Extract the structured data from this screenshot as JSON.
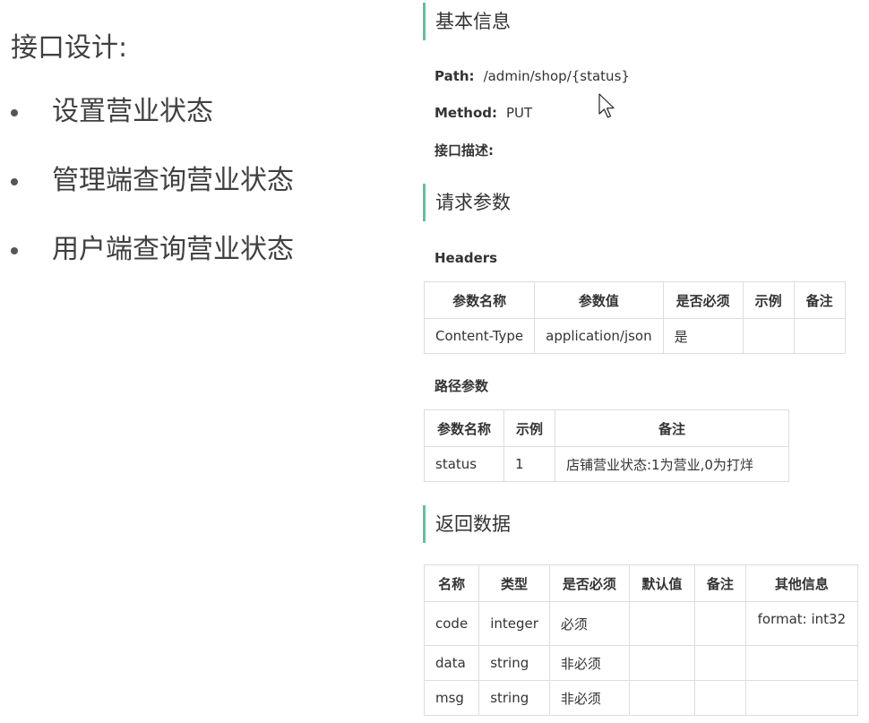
{
  "slide": {
    "title": "接口设计:",
    "bullets": [
      "设置营业状态",
      "管理端查询营业状态",
      "用户端查询营业状态"
    ]
  },
  "basic_info": {
    "heading": "基本信息",
    "path_label": "Path:",
    "path_value": "/admin/shop/{status}",
    "method_label": "Method:",
    "method_value": "PUT",
    "desc_label": "接口描述:"
  },
  "request": {
    "heading": "请求参数",
    "headers_label": "Headers",
    "headers_table": {
      "columns": [
        "参数名称",
        "参数值",
        "是否必须",
        "示例",
        "备注"
      ],
      "rows": [
        [
          "Content-Type",
          "application/json",
          "是",
          "",
          ""
        ]
      ]
    },
    "path_params_label": "路径参数",
    "path_table": {
      "columns": [
        "参数名称",
        "示例",
        "备注"
      ],
      "rows": [
        [
          "status",
          "1",
          "店铺营业状态:1为营业,0为打烊"
        ]
      ]
    }
  },
  "response": {
    "heading": "返回数据",
    "table": {
      "columns": [
        "名称",
        "类型",
        "是否必须",
        "默认值",
        "备注",
        "其他信息"
      ],
      "rows": [
        [
          "code",
          "integer",
          "必须",
          "",
          "",
          "format: int32"
        ],
        [
          "data",
          "string",
          "非必须",
          "",
          "",
          ""
        ],
        [
          "msg",
          "string",
          "非必须",
          "",
          "",
          ""
        ]
      ]
    }
  },
  "colors": {
    "accent_bar": "#5cc2a0",
    "border": "#dddddd",
    "text": "#333333"
  },
  "icons": {
    "cursor": "mouse-pointer-icon",
    "bullet": "bullet-dot-icon"
  }
}
